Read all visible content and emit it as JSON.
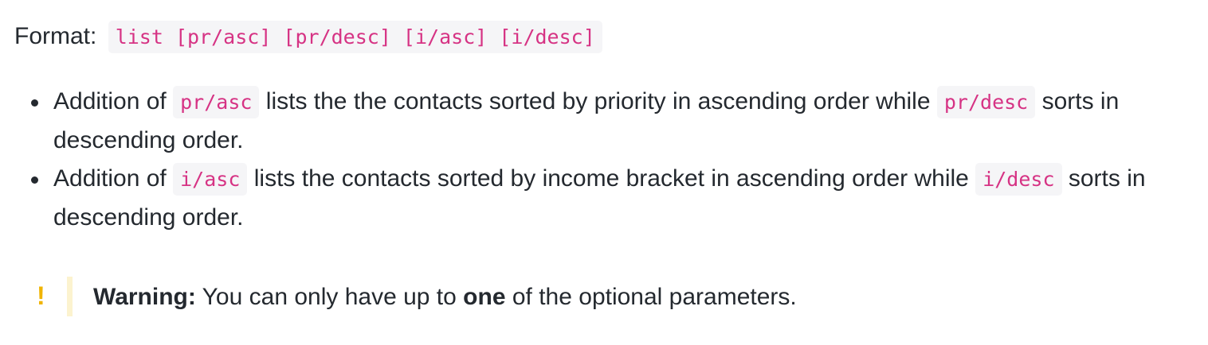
{
  "format": {
    "label": "Format:",
    "code": "list [pr/asc] [pr/desc] [i/asc] [i/desc]"
  },
  "bullets": [
    {
      "t1": "Addition of",
      "code1": "pr/asc",
      "t2": "lists the the contacts sorted by priority in ascending order while",
      "code2": "pr/desc",
      "t3": "sorts in descending order."
    },
    {
      "t1": "Addition of",
      "code1": "i/asc",
      "t2": "lists the contacts sorted by income bracket in ascending order while",
      "code2": "i/desc",
      "t3": "sorts in descending order."
    }
  ],
  "warning": {
    "icon": "!",
    "label": "Warning:",
    "text_before": "You can only have up to",
    "emphasis": "one",
    "text_after": "of the optional parameters."
  }
}
